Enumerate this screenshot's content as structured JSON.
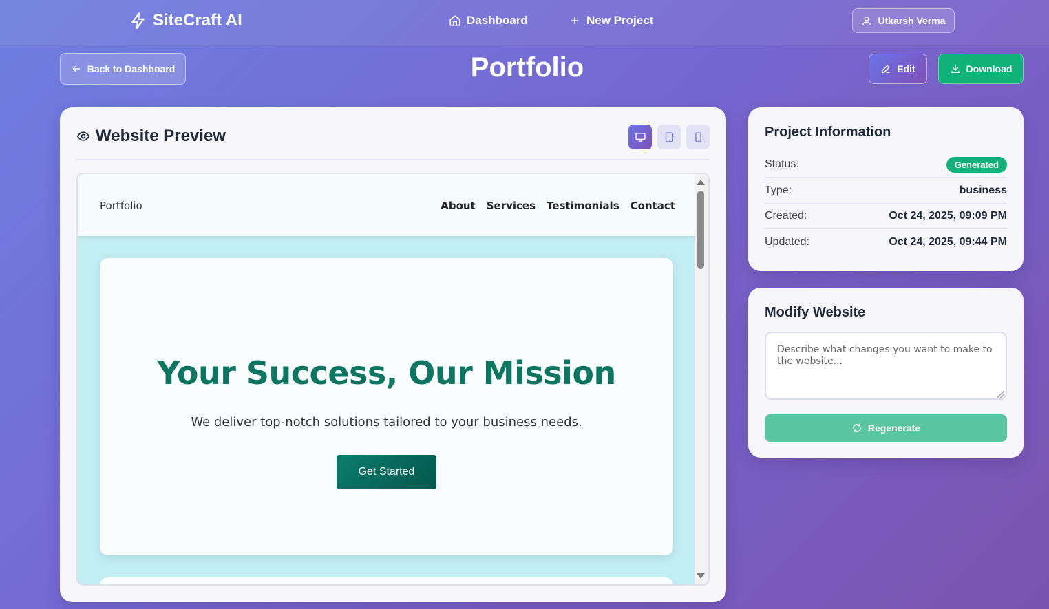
{
  "app": {
    "brand": "SiteCraft AI"
  },
  "nav": {
    "dashboard": "Dashboard",
    "new_project": "New Project",
    "user": "Utkarsh Verma"
  },
  "toolbar": {
    "back": "Back to Dashboard",
    "title": "Portfolio",
    "edit": "Edit",
    "download": "Download"
  },
  "preview": {
    "title": "Website Preview",
    "devices": [
      "desktop",
      "tablet",
      "mobile"
    ],
    "active_device": "desktop",
    "site": {
      "brand": "Portfolio",
      "links": [
        "About",
        "Services",
        "Testimonials",
        "Contact"
      ],
      "hero_heading": "Your Success, Our Mission",
      "hero_text": "We deliver top-notch solutions tailored to your business needs.",
      "hero_button": "Get Started"
    }
  },
  "project_info": {
    "title": "Project Information",
    "status_label": "Status:",
    "status_value": "Generated",
    "type_label": "Type:",
    "type_value": "business",
    "created_label": "Created:",
    "created_value": "Oct 24, 2025, 09:09 PM",
    "updated_label": "Updated:",
    "updated_value": "Oct 24, 2025, 09:44 PM"
  },
  "modify": {
    "title": "Modify Website",
    "placeholder": "Describe what changes you want to make to the website...",
    "value": "",
    "button": "Regenerate"
  },
  "colors": {
    "accent": "#10b27a",
    "brand_gradient_start": "#6a74e8",
    "brand_gradient_end": "#7f4fb6",
    "hero_heading": "#0d7560"
  }
}
